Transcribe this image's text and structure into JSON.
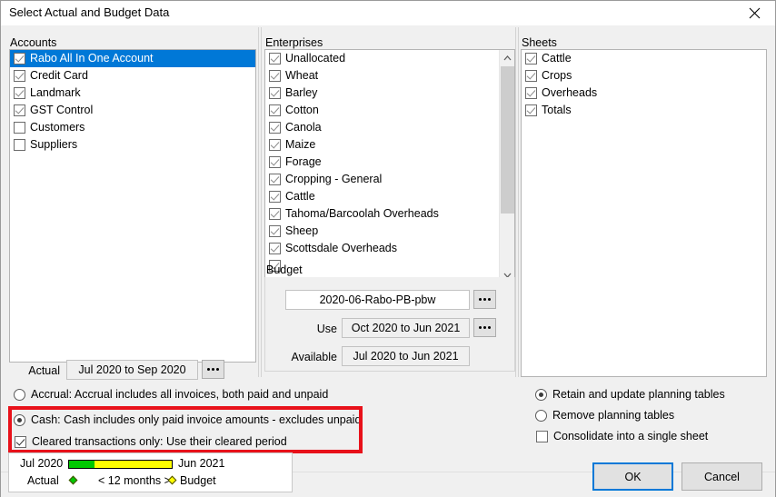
{
  "window": {
    "title": "Select Actual and Budget Data",
    "close_icon": "close-icon"
  },
  "accounts": {
    "label": "Accounts",
    "items": [
      {
        "label": "Rabo All In One Account",
        "checked": true,
        "selected": true
      },
      {
        "label": "Credit Card",
        "checked": true,
        "selected": false
      },
      {
        "label": "Landmark",
        "checked": true,
        "selected": false
      },
      {
        "label": "GST Control",
        "checked": true,
        "selected": false
      },
      {
        "label": "Customers",
        "checked": false,
        "selected": false
      },
      {
        "label": "Suppliers",
        "checked": false,
        "selected": false
      }
    ],
    "actual": {
      "label": "Actual",
      "value": "Jul 2020 to Sep 2020",
      "browse_label": "..."
    }
  },
  "enterprises": {
    "label": "Enterprises",
    "items": [
      {
        "label": "Unallocated",
        "checked": true
      },
      {
        "label": "Wheat",
        "checked": true
      },
      {
        "label": "Barley",
        "checked": true
      },
      {
        "label": "Cotton",
        "checked": true
      },
      {
        "label": "Canola",
        "checked": true
      },
      {
        "label": "Maize",
        "checked": true
      },
      {
        "label": "Forage",
        "checked": true
      },
      {
        "label": "Cropping - General",
        "checked": true
      },
      {
        "label": "Cattle",
        "checked": true
      },
      {
        "label": "Tahoma/Barcoolah Overheads",
        "checked": true
      },
      {
        "label": "Sheep",
        "checked": true
      },
      {
        "label": "Scottsdale Overheads",
        "checked": true
      }
    ],
    "scroll_up_icon": "chevron-up-icon",
    "scroll_down_icon": "chevron-down-icon"
  },
  "budget": {
    "label": "Budget",
    "name_value": "2020-06-Rabo-PB-pbw",
    "name_browse_label": "...",
    "use_label": "Use",
    "use_value": "Oct 2020 to Jun 2021",
    "use_browse_label": "...",
    "available_label": "Available",
    "available_value": "Jul 2020 to Jun 2021"
  },
  "sheets": {
    "label": "Sheets",
    "items": [
      {
        "label": "Cattle",
        "checked": true
      },
      {
        "label": "Crops",
        "checked": true
      },
      {
        "label": "Overheads",
        "checked": true
      },
      {
        "label": "Totals",
        "checked": true
      }
    ]
  },
  "accounting_basis": {
    "accrual": {
      "label": "Accrual: Accrual includes all invoices, both paid and unpaid",
      "selected": false
    },
    "cash": {
      "label": "Cash: Cash includes only paid invoice amounts - excludes unpaid",
      "selected": true
    },
    "cleared": {
      "label": "Cleared transactions only: Use their cleared period",
      "checked": true
    },
    "highlight_color": "#e8111a"
  },
  "planning_options": {
    "retain": {
      "label": "Retain and update planning tables",
      "selected": true
    },
    "remove": {
      "label": "Remove planning tables",
      "selected": false
    },
    "consolidate": {
      "label": "Consolidate into a single sheet",
      "checked": false
    }
  },
  "timeline": {
    "start_label": "Jul 2020",
    "end_label": "Jun 2021",
    "actual_label": "Actual",
    "budget_label": "Budget",
    "range_label": "< 12 months >",
    "actual_fraction_percent": 25,
    "actual_color": "#00c800",
    "budget_color": "#ffff00"
  },
  "footer": {
    "ok_label": "OK",
    "cancel_label": "Cancel"
  }
}
